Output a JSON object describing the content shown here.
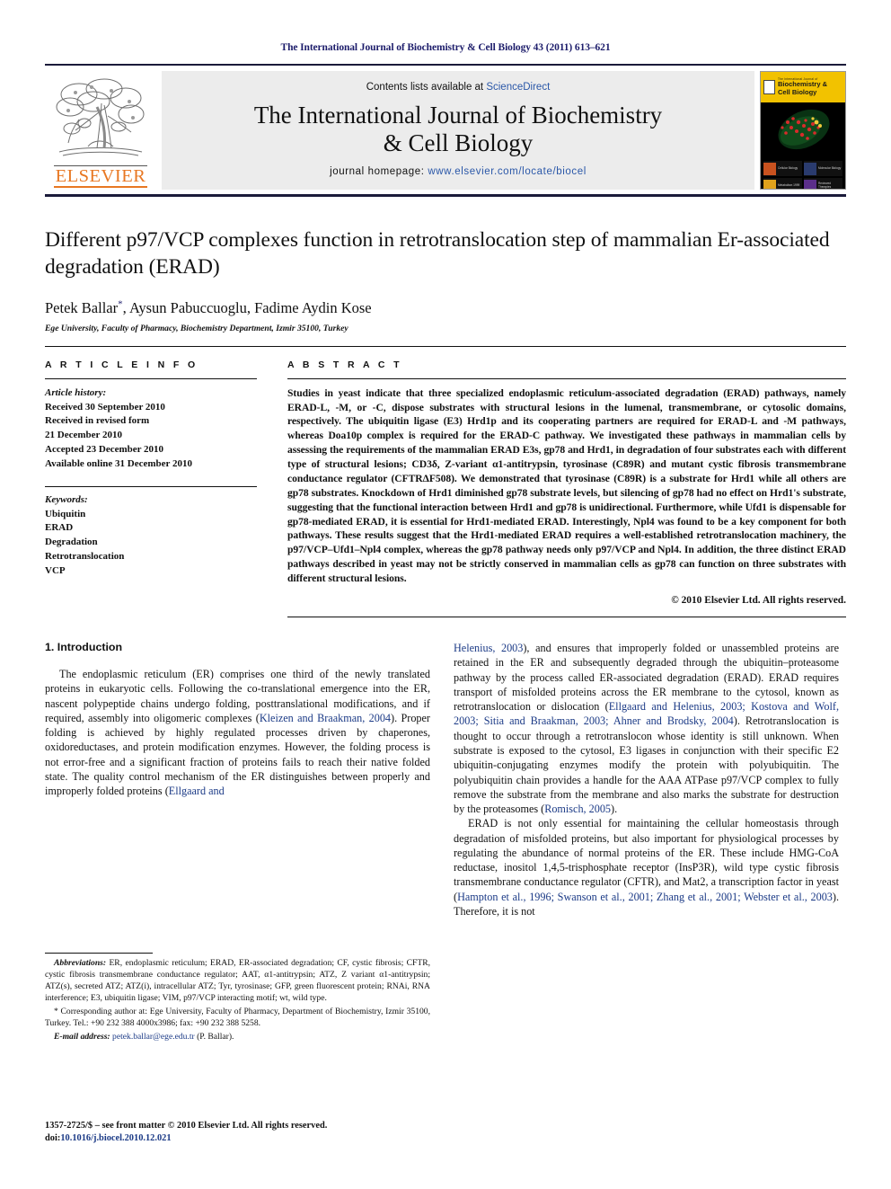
{
  "running_head": "The International Journal of Biochemistry & Cell Biology 43 (2011) 613–621",
  "masthead": {
    "publisher_name": "ELSEVIER",
    "contents_prefix": "Contents lists available at ",
    "contents_link": "ScienceDirect",
    "journal_title_line1": "The International Journal of Biochemistry",
    "journal_title_line2": "& Cell Biology",
    "homepage_label": "journal homepage: ",
    "homepage_url": "www.elsevier.com/locate/biocel",
    "cover": {
      "masthead_small": "The International Journal of",
      "title_line1": "Biochemistry &",
      "title_line2": "Cell Biology",
      "cell_labels": [
        "Cellular Biology",
        "Molecular Biology",
        "Metabolism 1999",
        "Reviewed Therapies"
      ]
    },
    "accent_orange": "#e87722",
    "link_blue": "#2a57a8",
    "cover_yellow": "#f2c200"
  },
  "article": {
    "title": "Different p97/VCP complexes function in retrotranslocation step of mammalian Er-associated degradation (ERAD)",
    "authors": "Petek Ballar, Aysun Pabuccuoglu, Fadime Aydin Kose",
    "corresponding_marker": "*",
    "affiliation": "Ege University, Faculty of Pharmacy, Biochemistry Department, Izmir 35100, Turkey"
  },
  "article_info": {
    "heading": "A R T I C L E   I N F O",
    "history_label": "Article history:",
    "history": [
      "Received 30 September 2010",
      "Received in revised form",
      "21 December 2010",
      "Accepted 23 December 2010",
      "Available online 31 December 2010"
    ],
    "keywords_label": "Keywords:",
    "keywords": [
      "Ubiquitin",
      "ERAD",
      "Degradation",
      "Retrotranslocation",
      "VCP"
    ]
  },
  "abstract": {
    "heading": "A B S T R A C T",
    "text": "Studies in yeast indicate that three specialized endoplasmic reticulum-associated degradation (ERAD) pathways, namely ERAD-L, -M, or -C, dispose substrates with structural lesions in the lumenal, transmembrane, or cytosolic domains, respectively. The ubiquitin ligase (E3) Hrd1p and its cooperating partners are required for ERAD-L and -M pathways, whereas Doa10p complex is required for the ERAD-C pathway. We investigated these pathways in mammalian cells by assessing the requirements of the mammalian ERAD E3s, gp78 and Hrd1, in degradation of four substrates each with different type of structural lesions; CD3δ, Z-variant α1-antitrypsin, tyrosinase (C89R) and mutant cystic fibrosis transmembrane conductance regulator (CFTRΔF508). We demonstrated that tyrosinase (C89R) is a substrate for Hrd1 while all others are gp78 substrates. Knockdown of Hrd1 diminished gp78 substrate levels, but silencing of gp78 had no effect on Hrd1's substrate, suggesting that the functional interaction between Hrd1 and gp78 is unidirectional. Furthermore, while Ufd1 is dispensable for gp78-mediated ERAD, it is essential for Hrd1-mediated ERAD. Interestingly, Npl4 was found to be a key component for both pathways. These results suggest that the Hrd1-mediated ERAD requires a well-established retrotranslocation machinery, the p97/VCP–Ufd1–Npl4 complex, whereas the gp78 pathway needs only p97/VCP and Npl4. In addition, the three distinct ERAD pathways described in yeast may not be strictly conserved in mammalian cells as gp78 can function on three substrates with different structural lesions.",
    "copyright": "© 2010 Elsevier Ltd. All rights reserved."
  },
  "introduction": {
    "heading": "1.  Introduction",
    "left_paragraph_1": "The endoplasmic reticulum (ER) comprises one third of the newly translated proteins in eukaryotic cells. Following the co-translational emergence into the ER, nascent polypeptide chains undergo folding, posttranslational modifications, and if required, assembly into oligomeric complexes (",
    "left_ref_1": "Kleizen and Braakman, 2004",
    "left_paragraph_1b": "). Proper folding is achieved by highly regulated processes driven by chaperones, oxidoreductases, and protein modification enzymes. However, the folding process is not error-free and a significant fraction of proteins fails to reach their native folded state. The quality control mechanism of the ER distinguishes between properly and improperly folded proteins (",
    "left_ref_2": "Ellgaard and",
    "right_ref_cont": "Helenius, 2003",
    "right_paragraph_1": "), and ensures that improperly folded or unassembled proteins are retained in the ER and subsequently degraded through the ubiquitin–proteasome pathway by the process called ER-associated degradation (ERAD). ERAD requires transport of misfolded proteins across the ER membrane to the cytosol, known as retrotranslocation or dislocation (",
    "right_ref_1": "Ellgaard and Helenius, 2003; Kostova and Wolf, 2003; Sitia and Braakman, 2003; Ahner and Brodsky, 2004",
    "right_paragraph_1b": "). Retrotranslocation is thought to occur through a retrotranslocon whose identity is still unknown. When substrate is exposed to the cytosol, E3 ligases in conjunction with their specific E2 ubiquitin-conjugating enzymes modify the protein with polyubiquitin. The polyubiquitin chain provides a handle for the AAA ATPase p97/VCP complex to fully remove the substrate from the membrane and also marks the substrate for destruction by the proteasomes (",
    "right_ref_2": "Romisch, 2005",
    "right_paragraph_1c": ").",
    "right_paragraph_2": "ERAD is not only essential for maintaining the cellular homeostasis through degradation of misfolded proteins, but also important for physiological processes by regulating the abundance of normal proteins of the ER. These include HMG-CoA reductase, inositol 1,4,5-trisphosphate receptor (InsP3R), wild type cystic fibrosis transmembrane conductance regulator (CFTR), and Mat2, a transcription factor in yeast (",
    "right_ref_3": "Hampton et al., 1996; Swanson et al., 2001; Zhang et al., 2001; Webster et al., 2003",
    "right_paragraph_2b": "). Therefore, it is not"
  },
  "footnotes": {
    "abbreviations_label": "Abbreviations:",
    "abbreviations_text": " ER, endoplasmic reticulum; ERAD, ER-associated degradation; CF, cystic fibrosis; CFTR, cystic fibrosis transmembrane conductance regulator; AAT, α1-antitrypsin; ATZ, Z variant α1-antitrypsin; ATZ(s), secreted ATZ; ATZ(i), intracellular ATZ; Tyr, tyrosinase; GFP, green fluorescent protein; RNAi, RNA interference; E3, ubiquitin ligase; VIM, p97/VCP interacting motif; wt, wild type.",
    "corresponding_text": "* Corresponding author at: Ege University, Faculty of Pharmacy, Department of Biochemistry, Izmir 35100, Turkey. Tel.: +90 232 388 4000x3986; fax: +90 232 388 5258.",
    "email_label": "E-mail address:",
    "email": "petek.ballar@ege.edu.tr",
    "email_suffix": " (P. Ballar)."
  },
  "issn_block": {
    "line1": "1357-2725/$ – see front matter © 2010 Elsevier Ltd. All rights reserved.",
    "doi_label": "doi:",
    "doi": "10.1016/j.biocel.2010.12.021"
  }
}
